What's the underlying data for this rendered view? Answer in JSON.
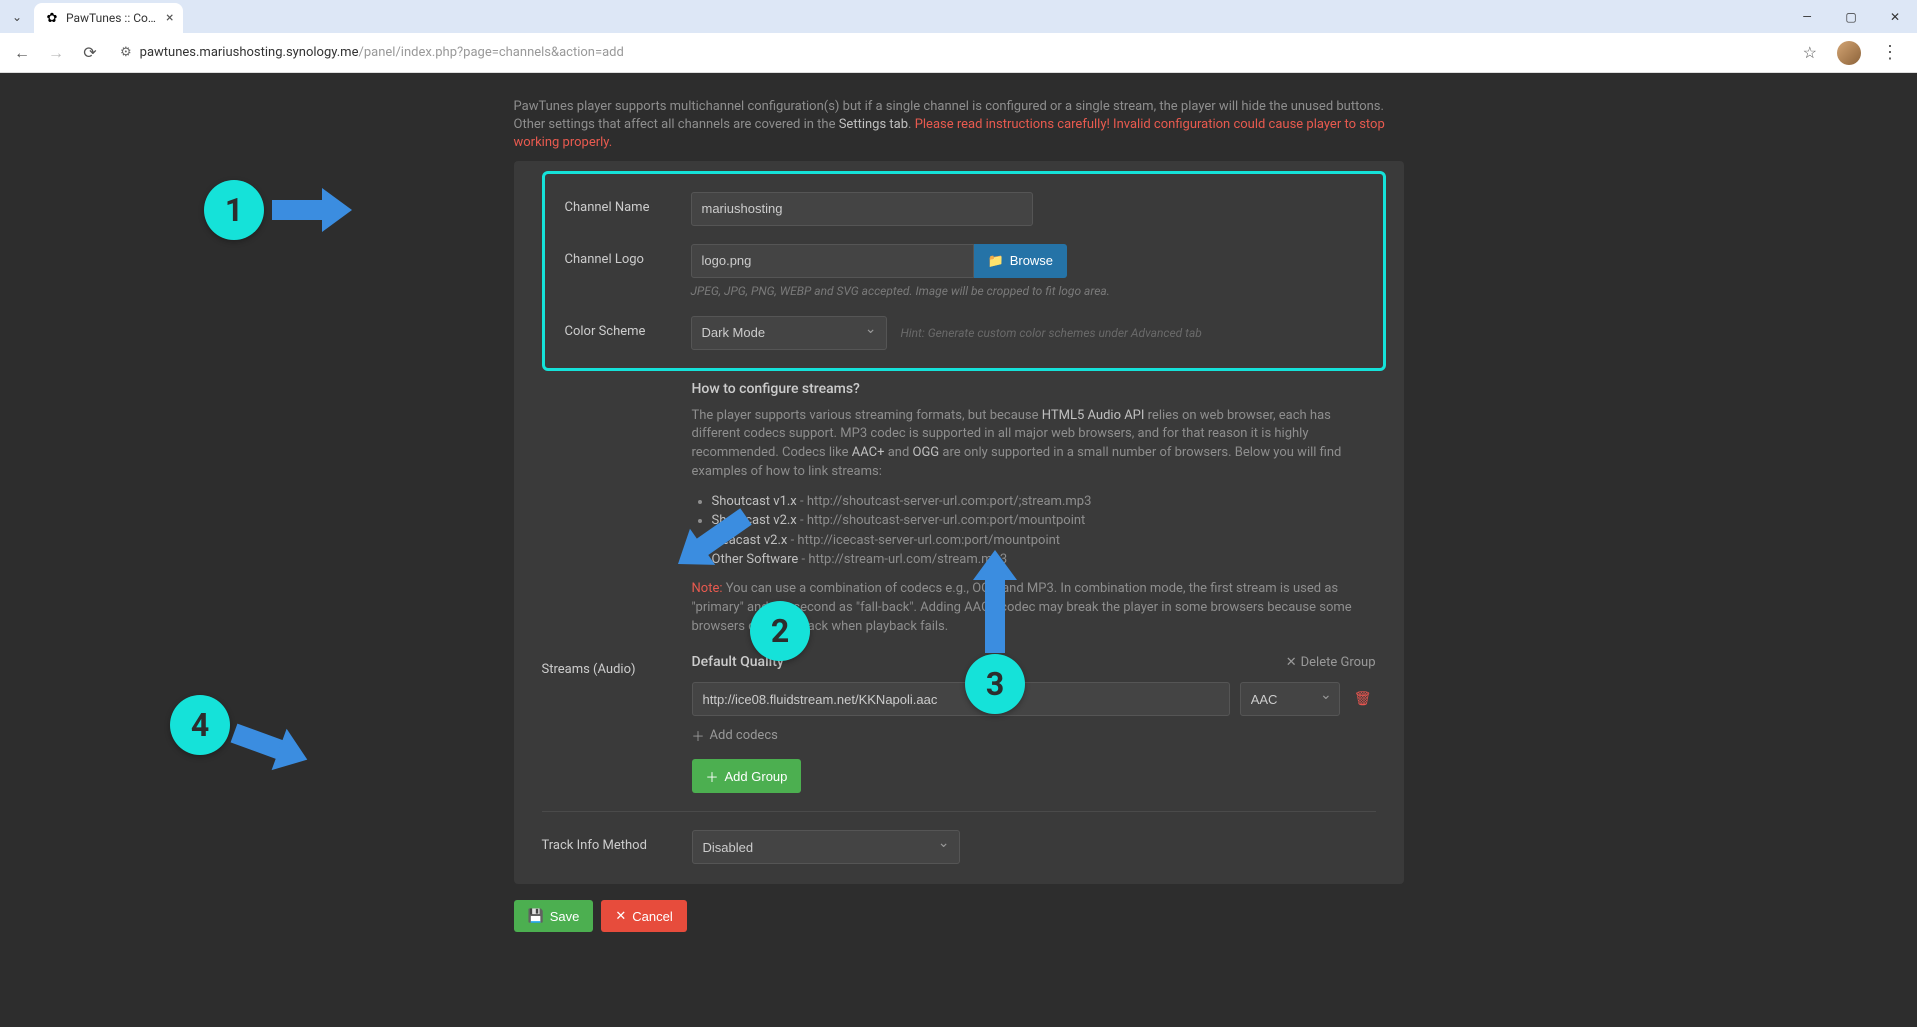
{
  "browser": {
    "tab_title": "PawTunes :: Control P",
    "url_prefix": "pawtunes.mariushosting.synology.me",
    "url_path": "/panel/index.php?page=channels&action=add"
  },
  "intro": {
    "line1_a": "PawTunes player supports multichannel configuration(s) but if a single channel is configured or a single stream, the player will hide the unused buttons. Other settings that affect all channels are covered in the ",
    "line1_b": "Settings tab",
    "warning": "Please read instructions carefully! Invalid configuration could cause player to stop working properly."
  },
  "form": {
    "channel_name_label": "Channel Name",
    "channel_name_value": "mariushosting",
    "channel_logo_label": "Channel Logo",
    "channel_logo_value": "logo.png",
    "browse_label": "Browse",
    "logo_hint": "JPEG, JPG, PNG, WEBP and SVG accepted. Image will be cropped to fit logo area.",
    "color_scheme_label": "Color Scheme",
    "color_scheme_value": "Dark Mode",
    "color_scheme_hint": "Hint: Generate custom color schemes under Advanced tab"
  },
  "streams_info": {
    "heading": "How to configure streams?",
    "p1_a": "The player supports various streaming formats, but because ",
    "p1_b": "HTML5 Audio API",
    "p1_c": " relies on web browser, each has different codecs support. MP3 codec is supported in all major web browsers, and for that reason it is highly recommended. Codecs like ",
    "p1_d": "AAC+",
    "p1_e": " and ",
    "p1_f": "OGG",
    "p1_g": " are only supported in a small number of browsers. Below you will find examples of how to link streams:",
    "examples": [
      {
        "name": "Shoutcast v1.x",
        "url": "http://shoutcast-server-url.com:port/;stream.mp3"
      },
      {
        "name": "Shoutcast v2.x",
        "url": "http://shoutcast-server-url.com:port/mountpoint"
      },
      {
        "name": "Iceacast v2.x",
        "url": "http://icecast-server-url.com:port/mountpoint"
      },
      {
        "name": "Other Software",
        "url": "http://stream-url.com/stream.mp3"
      }
    ],
    "note_label": "Note:",
    "note_text": " You can use a combination of codecs e.g., OGG and MP3. In combination mode, the first stream is used as \"primary\" and the second as \"fall-back\". Adding AAC+ codec may break the player in some browsers because some browsers don't fall back when playback fails."
  },
  "streams": {
    "label": "Streams (Audio)",
    "quality_title": "Default Quality",
    "delete_group": "Delete Group",
    "stream_url": "http://ice08.fluidstream.net/KKNapoli.aac",
    "codec": "AAC",
    "add_codecs": "Add codecs",
    "add_group": "Add Group"
  },
  "track_info": {
    "label": "Track Info Method",
    "value": "Disabled"
  },
  "actions": {
    "save": "Save",
    "cancel": "Cancel"
  },
  "annotations": {
    "b1": "1",
    "b2": "2",
    "b3": "3",
    "b4": "4"
  }
}
